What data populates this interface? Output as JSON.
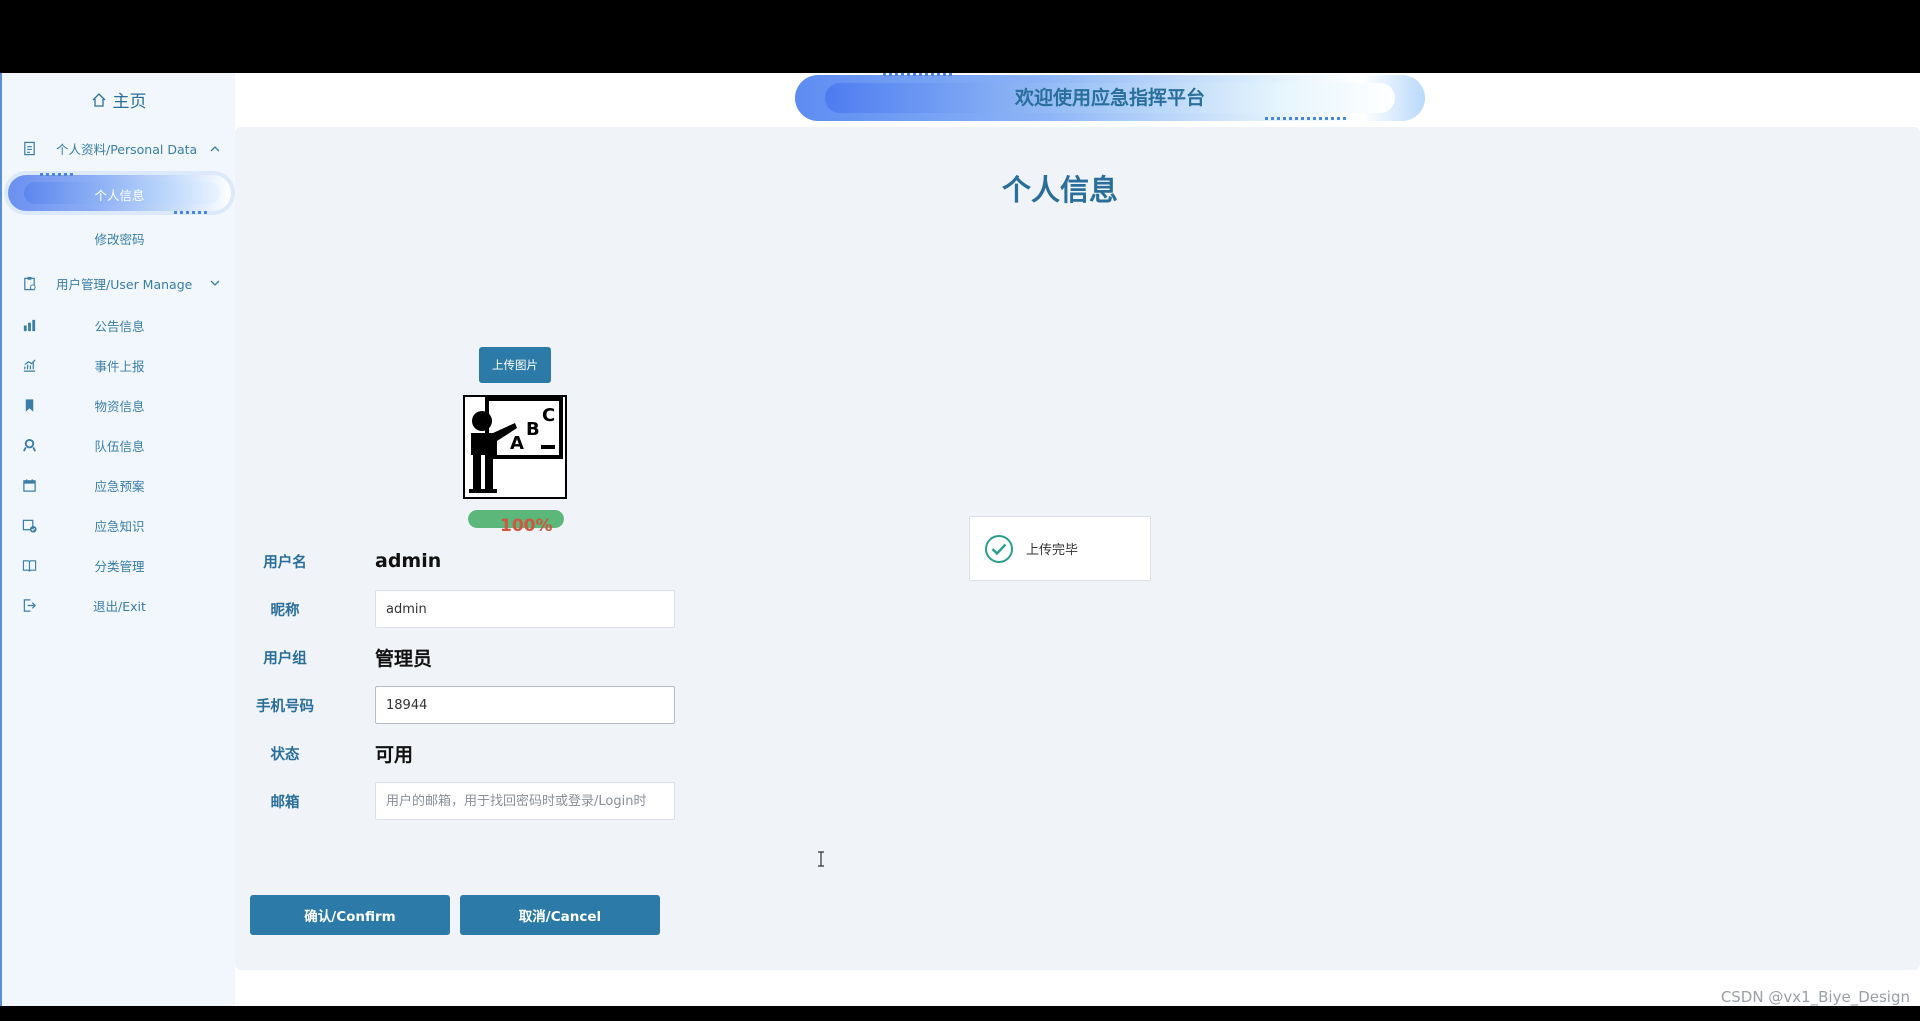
{
  "header": {
    "title": "欢迎使用应急指挥平台"
  },
  "sidebar": {
    "home": "主页",
    "groups": [
      {
        "label": "个人资料/Personal Data",
        "expanded": true,
        "items": [
          {
            "label": "个人信息",
            "active": true
          },
          {
            "label": "修改密码"
          }
        ]
      },
      {
        "label": "用户管理/User Manage",
        "expanded": false
      }
    ],
    "items": [
      {
        "label": "公告信息",
        "icon": "announcement-icon"
      },
      {
        "label": "事件上报",
        "icon": "chart-icon"
      },
      {
        "label": "物资信息",
        "icon": "bookmark-icon"
      },
      {
        "label": "队伍信息",
        "icon": "team-icon"
      },
      {
        "label": "应急预案",
        "icon": "calendar-icon"
      },
      {
        "label": "应急知识",
        "icon": "calendar-check-icon"
      },
      {
        "label": "分类管理",
        "icon": "book-icon"
      },
      {
        "label": "退出/Exit",
        "icon": "exit-icon"
      }
    ]
  },
  "main": {
    "title": "个人信息",
    "upload_button": "上传图片",
    "progress": {
      "percent": 100,
      "text": "100%",
      "color": "#5cb87a"
    },
    "form": {
      "username_label": "用户名",
      "username": "admin",
      "nickname_label": "昵称",
      "nickname": "admin",
      "group_label": "用户组",
      "group": "管理员",
      "phone_label": "手机号码",
      "phone": "18944",
      "status_label": "状态",
      "status": "可用",
      "email_label": "邮箱",
      "email_placeholder": "用户的邮箱，用于找回密码时或登录/Login时"
    },
    "confirm_button": "确认/Confirm",
    "cancel_button": "取消/Cancel"
  },
  "toast": {
    "message": "上传完毕"
  },
  "watermark": "CSDN @vx1_Biye_Design",
  "colors": {
    "primary": "#2c7aa7",
    "text_blue": "#2a6f9b",
    "success": "#5cb87a",
    "danger": "#d2553f"
  }
}
